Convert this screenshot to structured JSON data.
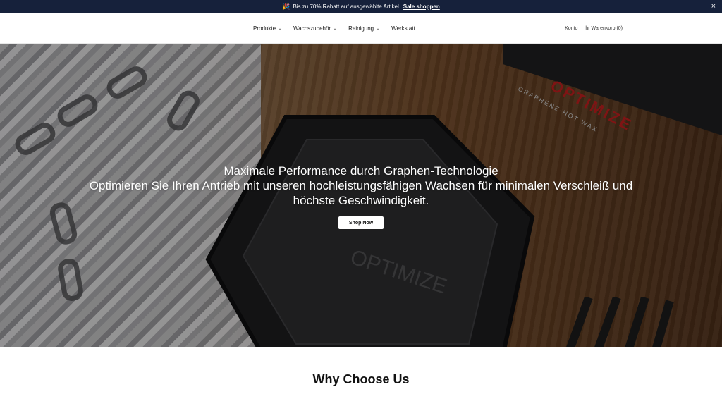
{
  "announcement": {
    "icon": "party-popper-icon",
    "emoji": "🎉",
    "text": "Bis zu 70% Rabatt auf ausgewählte Artikel",
    "link": "Sale shoppen",
    "close": "×"
  },
  "nav": {
    "items": [
      {
        "label": "Produkte",
        "dropdown": true
      },
      {
        "label": "Wachszubehör",
        "dropdown": true
      },
      {
        "label": "Reinigung",
        "dropdown": true
      },
      {
        "label": "Werkstatt",
        "dropdown": false
      }
    ]
  },
  "header_right": {
    "account": "Konto",
    "cart": "Ihr Warenkorb (0)"
  },
  "hero": {
    "title": "Maximale Performance durch Graphen-Technologie",
    "subtitle_line1": "Optimieren Sie Ihren Antrieb mit unseren hochleistungsfähigen Wachsen für minimalen Verschleiß und",
    "subtitle_line2": "höchste Geschwindigkeit.",
    "cta": "Shop Now",
    "image_text": {
      "brand": "OPTIMIZE",
      "product": "GRAPHENE-HOT WAX",
      "puck_brand": "OPTIMIZE"
    }
  },
  "section": {
    "title": "Why Choose Us"
  },
  "colors": {
    "announce_bg": "#16213b",
    "brand_red": "#b11c1c"
  }
}
